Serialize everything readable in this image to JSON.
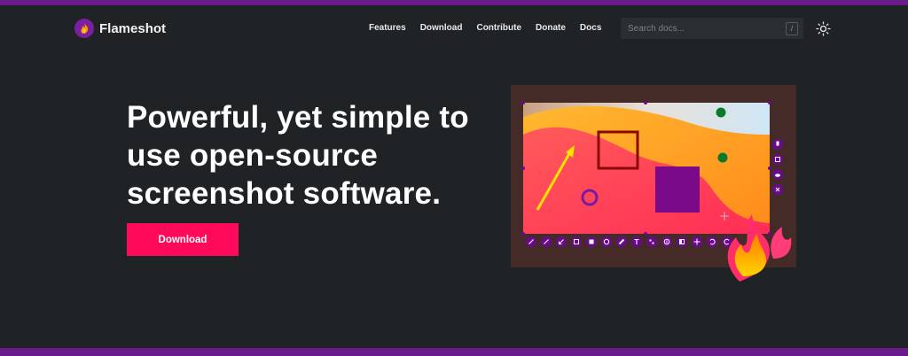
{
  "brand": {
    "name": "Flameshot",
    "logo_icon": "flame-logo-icon"
  },
  "nav": {
    "links": [
      {
        "label": "Features"
      },
      {
        "label": "Download"
      },
      {
        "label": "Contribute"
      },
      {
        "label": "Donate"
      },
      {
        "label": "Docs"
      }
    ]
  },
  "search": {
    "placeholder": "Search docs...",
    "shortcut": "/"
  },
  "theme_toggle": {
    "icon": "sun-icon"
  },
  "hero": {
    "title": "Powerful, yet simple to use open-source screenshot software.",
    "cta_label": "Download"
  },
  "colors": {
    "background": "#202326",
    "accent_bar": "#6a1b8a",
    "cta": "#ff0a5a",
    "tool_purple": "#6a0a8a"
  },
  "illustration": {
    "side_tools": [
      "pin-icon",
      "clipboard-icon",
      "upload-cloud-icon",
      "close-icon"
    ],
    "bottom_tools": [
      "pencil-icon",
      "line-icon",
      "arrow-icon",
      "rectangle-outline-icon",
      "rectangle-filled-icon",
      "circle-icon",
      "marker-icon",
      "text-icon",
      "pixelate-icon",
      "counter-icon",
      "invert-icon",
      "move-icon",
      "undo-icon",
      "redo-icon"
    ]
  }
}
